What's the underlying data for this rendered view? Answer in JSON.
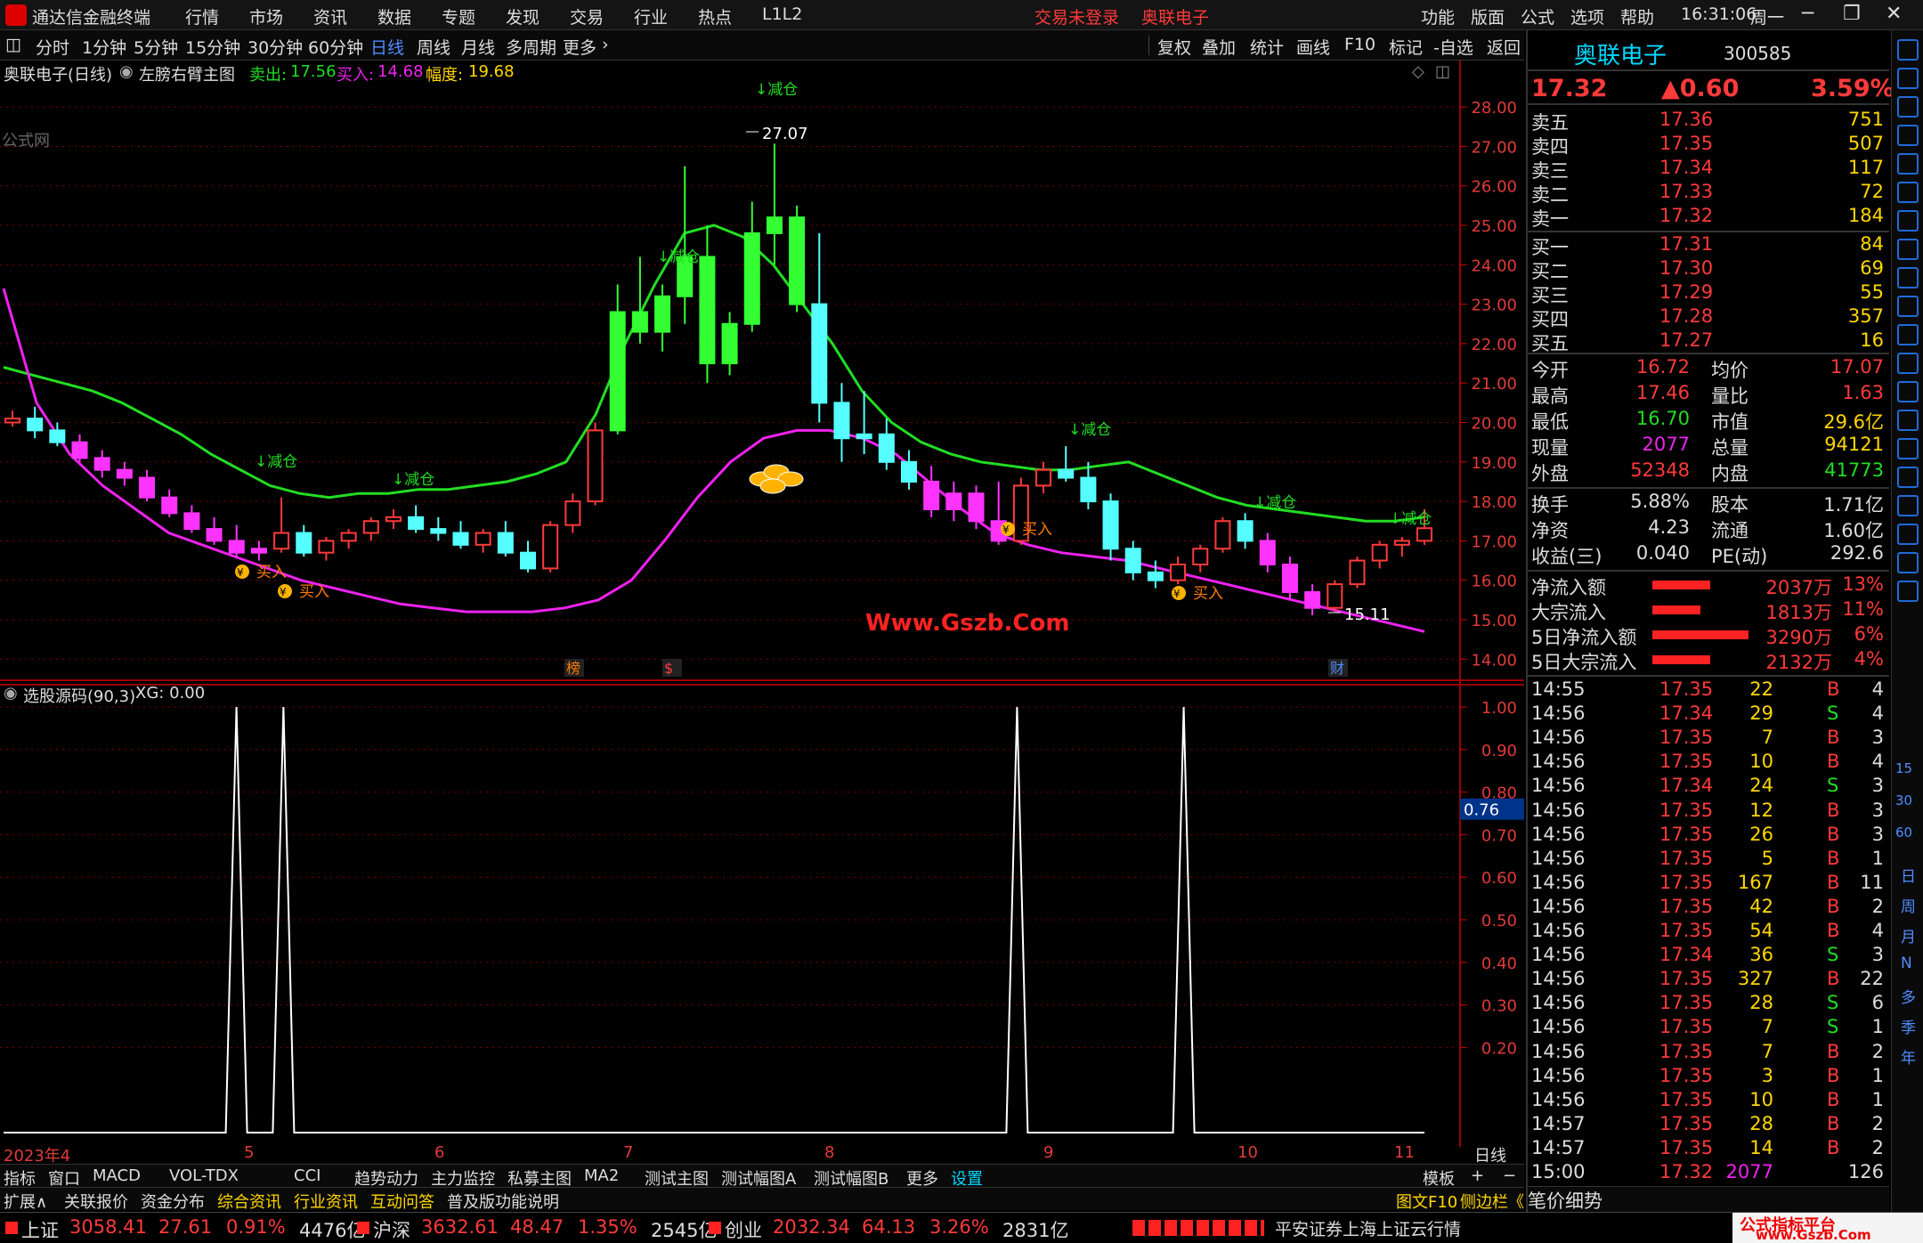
{
  "menubar": {
    "app_name": "通达信金融终端",
    "items": [
      "行情",
      "市场",
      "资讯",
      "数据",
      "专题",
      "发现",
      "交易",
      "行业",
      "热点",
      "L1L2"
    ],
    "notice": "交易未登录",
    "stock": "奥联电子",
    "right_items": [
      "功能",
      "版面",
      "公式",
      "选项",
      "帮助"
    ],
    "clock": "16:31:06",
    "weekday": "周一"
  },
  "toolbar": {
    "periods": [
      "分时",
      "1分钟",
      "5分钟",
      "15分钟",
      "30分钟",
      "60分钟",
      "日线",
      "周线",
      "月线",
      "多周期",
      "更多"
    ],
    "active_period": "日线",
    "tools": [
      "复权",
      "叠加",
      "统计",
      "画线",
      "F10",
      "标记",
      "-自选",
      "返回"
    ]
  },
  "infobar": {
    "stock_title": "奥联电子(日线)",
    "indicator": "左膀右臂主图",
    "sell_label": "卖出:",
    "sell_value": "17.56",
    "buy_label": "买入:",
    "buy_value": "14.68",
    "amp_label": "幅度:",
    "amp_value": "19.68",
    "watermark": "公式网"
  },
  "chart_data": [
    {
      "type": "candlestick",
      "title": "奥联电子(日线)",
      "y_ticks": [
        "28.00",
        "27.00",
        "26.00",
        "25.00",
        "24.00",
        "23.00",
        "22.00",
        "21.00",
        "20.00",
        "19.00",
        "18.00",
        "17.00",
        "16.00",
        "15.00",
        "14.00"
      ],
      "ylim": [
        13.6,
        28.5
      ],
      "x_ticks": [
        "2023年4",
        "5",
        "6",
        "7",
        "8",
        "9",
        "10",
        "11"
      ],
      "annotations": {
        "high": "27.07",
        "low": "15.11",
        "reduce": "↓减仓",
        "buy": "买入",
        "money": "¥",
        "site": "Www.Gszb.Com"
      },
      "markers": [
        "榜",
        "$",
        "财"
      ],
      "series": [
        {
          "name": "upper",
          "color": "#22dd22",
          "values": [
            21.4,
            21.2,
            21.0,
            20.8,
            20.5,
            20.1,
            19.7,
            19.2,
            18.8,
            18.4,
            18.2,
            18.1,
            18.2,
            18.2,
            18.3,
            18.3,
            18.4,
            18.5,
            18.7,
            19.0,
            20.2,
            22.0,
            23.5,
            24.8,
            25.0,
            24.7,
            24.0,
            23.0,
            22.0,
            20.8,
            20.0,
            19.5,
            19.2,
            19.0,
            18.9,
            18.8,
            18.8,
            18.9,
            19.0,
            18.7,
            18.4,
            18.1,
            17.9,
            17.8,
            17.7,
            17.6,
            17.5,
            17.5,
            17.6
          ]
        },
        {
          "name": "lower",
          "color": "#ee22ee",
          "values": [
            23.4,
            20.5,
            19.2,
            18.4,
            17.8,
            17.2,
            16.9,
            16.6,
            16.3,
            16.0,
            15.8,
            15.6,
            15.4,
            15.3,
            15.2,
            15.2,
            15.2,
            15.3,
            15.5,
            16.0,
            17.0,
            18.1,
            19.0,
            19.6,
            19.8,
            19.8,
            19.6,
            19.2,
            18.5,
            17.8,
            17.2,
            16.9,
            16.7,
            16.6,
            16.5,
            16.3,
            16.1,
            15.9,
            15.7,
            15.5,
            15.3,
            15.1,
            14.9,
            14.7
          ]
        },
        {
          "name": "candles",
          "values": [
            [
              20.0,
              20.3,
              19.9,
              20.1
            ],
            [
              20.1,
              20.4,
              19.6,
              19.8
            ],
            [
              19.8,
              20.0,
              19.4,
              19.5
            ],
            [
              19.5,
              19.7,
              19.0,
              19.1
            ],
            [
              19.1,
              19.3,
              18.6,
              18.8
            ],
            [
              18.8,
              19.0,
              18.4,
              18.6
            ],
            [
              18.6,
              18.8,
              18.0,
              18.1
            ],
            [
              18.1,
              18.3,
              17.6,
              17.7
            ],
            [
              17.7,
              17.9,
              17.2,
              17.3
            ],
            [
              17.3,
              17.6,
              16.9,
              17.0
            ],
            [
              17.0,
              17.4,
              16.6,
              16.7
            ],
            [
              16.7,
              17.0,
              16.5,
              16.8
            ],
            [
              16.8,
              18.1,
              16.7,
              17.2
            ],
            [
              17.2,
              17.4,
              16.6,
              16.7
            ],
            [
              16.7,
              17.1,
              16.5,
              17.0
            ],
            [
              17.0,
              17.3,
              16.8,
              17.2
            ],
            [
              17.2,
              17.6,
              17.0,
              17.5
            ],
            [
              17.5,
              17.8,
              17.3,
              17.6
            ],
            [
              17.6,
              17.9,
              17.2,
              17.3
            ],
            [
              17.3,
              17.6,
              17.0,
              17.2
            ],
            [
              17.2,
              17.5,
              16.8,
              16.9
            ],
            [
              16.9,
              17.3,
              16.7,
              17.2
            ],
            [
              17.2,
              17.5,
              16.6,
              16.7
            ],
            [
              16.7,
              17.0,
              16.2,
              16.3
            ],
            [
              16.3,
              17.5,
              16.2,
              17.4
            ],
            [
              17.4,
              18.2,
              17.2,
              18.0
            ],
            [
              18.0,
              20.0,
              17.9,
              19.8
            ],
            [
              19.8,
              23.5,
              19.7,
              22.8
            ],
            [
              22.8,
              24.2,
              22.0,
              22.3
            ],
            [
              22.3,
              23.5,
              21.8,
              23.2
            ],
            [
              23.2,
              26.5,
              22.5,
              24.2
            ],
            [
              24.2,
              25.0,
              21.0,
              21.5
            ],
            [
              21.5,
              22.8,
              21.2,
              22.5
            ],
            [
              22.5,
              25.6,
              22.3,
              24.8
            ],
            [
              24.8,
              27.07,
              24.0,
              25.2
            ],
            [
              25.2,
              25.5,
              22.8,
              23.0
            ],
            [
              23.0,
              24.8,
              20.0,
              20.5
            ],
            [
              20.5,
              21.0,
              19.0,
              19.6
            ],
            [
              19.6,
              20.8,
              19.2,
              19.7
            ],
            [
              19.7,
              20.1,
              18.8,
              19.0
            ],
            [
              19.0,
              19.3,
              18.3,
              18.5
            ],
            [
              18.5,
              18.9,
              17.6,
              17.8
            ],
            [
              17.8,
              18.5,
              17.5,
              18.2
            ],
            [
              18.2,
              18.4,
              17.3,
              17.5
            ],
            [
              17.5,
              18.5,
              16.9,
              17.0
            ],
            [
              17.0,
              18.6,
              16.9,
              18.4
            ],
            [
              18.4,
              19.0,
              18.2,
              18.8
            ],
            [
              18.8,
              19.4,
              18.5,
              18.6
            ],
            [
              18.6,
              19.0,
              17.8,
              18.0
            ],
            [
              18.0,
              18.2,
              16.5,
              16.8
            ],
            [
              16.8,
              17.0,
              16.0,
              16.2
            ],
            [
              16.2,
              16.5,
              15.8,
              16.0
            ],
            [
              16.0,
              16.6,
              15.9,
              16.4
            ],
            [
              16.4,
              16.9,
              16.2,
              16.8
            ],
            [
              16.8,
              17.6,
              16.7,
              17.5
            ],
            [
              17.5,
              17.7,
              16.8,
              17.0
            ],
            [
              17.0,
              17.2,
              16.2,
              16.4
            ],
            [
              16.4,
              16.6,
              15.5,
              15.7
            ],
            [
              15.7,
              15.9,
              15.11,
              15.3
            ],
            [
              15.3,
              16.0,
              15.2,
              15.9
            ],
            [
              15.9,
              16.6,
              15.8,
              16.5
            ],
            [
              16.5,
              17.0,
              16.3,
              16.9
            ],
            [
              16.9,
              17.1,
              16.6,
              17.0
            ],
            [
              17.0,
              17.8,
              16.9,
              17.32
            ]
          ]
        }
      ]
    },
    {
      "type": "line",
      "title": "选股源码(90,3)",
      "legend": "XG: 0.00",
      "y_ticks": [
        "1.00",
        "0.90",
        "0.80",
        "0.70",
        "0.60",
        "0.50",
        "0.40",
        "0.30",
        "0.20"
      ],
      "ylim": [
        0,
        1.0
      ],
      "current": "0.76",
      "series": [
        {
          "name": "XG",
          "color": "#ffffff",
          "spikes": [
            0.166,
            0.199,
            0.714,
            0.831
          ]
        }
      ]
    }
  ],
  "quote": {
    "name": "奥联电子",
    "code": "300585",
    "price": "17.32",
    "change": "▲0.60",
    "pct": "3.59%",
    "asks": [
      {
        "label": "卖五",
        "price": "17.36",
        "vol": "751"
      },
      {
        "label": "卖四",
        "price": "17.35",
        "vol": "507"
      },
      {
        "label": "卖三",
        "price": "17.34",
        "vol": "117"
      },
      {
        "label": "卖二",
        "price": "17.33",
        "vol": "72"
      },
      {
        "label": "卖一",
        "price": "17.32",
        "vol": "184"
      }
    ],
    "bids": [
      {
        "label": "买一",
        "price": "17.31",
        "vol": "84"
      },
      {
        "label": "买二",
        "price": "17.30",
        "vol": "69"
      },
      {
        "label": "买三",
        "price": "17.29",
        "vol": "55"
      },
      {
        "label": "买四",
        "price": "17.28",
        "vol": "357"
      },
      {
        "label": "买五",
        "price": "17.27",
        "vol": "16"
      }
    ],
    "stats": [
      [
        "今开",
        "16.72",
        "均价",
        "17.07"
      ],
      [
        "最高",
        "17.46",
        "量比",
        "1.63"
      ],
      [
        "最低",
        "16.70",
        "市值",
        "29.6亿"
      ],
      [
        "现量",
        "2077",
        "总量",
        "94121"
      ],
      [
        "外盘",
        "52348",
        "内盘",
        "41773"
      ]
    ],
    "stats2": [
      [
        "换手",
        "5.88%",
        "股本",
        "1.71亿"
      ],
      [
        "净资",
        "4.23",
        "流通",
        "1.60亿"
      ],
      [
        "收益(三)",
        "0.040",
        "PE(动)",
        "292.6"
      ]
    ],
    "flows": [
      [
        "净流入额",
        "2037万",
        "13%",
        0.6
      ],
      [
        "大宗流入",
        "1813万",
        "11%",
        0.5
      ],
      [
        "5日净流入额",
        "3290万",
        "6%",
        1.0
      ],
      [
        "5日大宗流入",
        "2132万",
        "4%",
        0.6
      ]
    ],
    "ticks": [
      [
        "14:55",
        "17.35",
        "22",
        "B",
        "4"
      ],
      [
        "14:56",
        "17.34",
        "29",
        "S",
        "4"
      ],
      [
        "14:56",
        "17.35",
        "7",
        "B",
        "3"
      ],
      [
        "14:56",
        "17.35",
        "10",
        "B",
        "4"
      ],
      [
        "14:56",
        "17.34",
        "24",
        "S",
        "3"
      ],
      [
        "14:56",
        "17.35",
        "12",
        "B",
        "3"
      ],
      [
        "14:56",
        "17.35",
        "26",
        "B",
        "3"
      ],
      [
        "14:56",
        "17.35",
        "5",
        "B",
        "1"
      ],
      [
        "14:56",
        "17.35",
        "167",
        "B",
        "11"
      ],
      [
        "14:56",
        "17.35",
        "42",
        "B",
        "2"
      ],
      [
        "14:56",
        "17.35",
        "54",
        "B",
        "4"
      ],
      [
        "14:56",
        "17.34",
        "36",
        "S",
        "3"
      ],
      [
        "14:56",
        "17.35",
        "327",
        "B",
        "22"
      ],
      [
        "14:56",
        "17.35",
        "28",
        "S",
        "6"
      ],
      [
        "14:56",
        "17.35",
        "7",
        "S",
        "1"
      ],
      [
        "14:56",
        "17.35",
        "7",
        "B",
        "2"
      ],
      [
        "14:56",
        "17.35",
        "3",
        "B",
        "1"
      ],
      [
        "14:56",
        "17.35",
        "10",
        "B",
        "1"
      ],
      [
        "14:57",
        "17.35",
        "28",
        "B",
        "2"
      ],
      [
        "14:57",
        "17.35",
        "14",
        "B",
        "2"
      ],
      [
        "15:00",
        "17.32",
        "2077",
        "",
        "126"
      ]
    ],
    "bottom_tabs": [
      "笔",
      "价",
      "细",
      "势"
    ]
  },
  "tabs1": [
    "指标",
    "窗口",
    "MACD",
    "VOL-TDX",
    "CCI",
    "趋势动力",
    "主力监控",
    "私募主图",
    "MA2",
    "测试主图",
    "测试幅图A",
    "测试幅图B",
    "更多",
    "设置"
  ],
  "tabs1_right": [
    "模板",
    "+",
    "−"
  ],
  "tabs2": [
    "扩展∧",
    "关联报价",
    "资金分布",
    "综合资讯",
    "行业资讯",
    "互动问答",
    "普及版功能说明"
  ],
  "tabs2_right": [
    "图文F10",
    "侧边栏《"
  ],
  "status": {
    "indices": [
      [
        "上证",
        "3058.41",
        "27.61",
        "0.91%",
        "4476亿"
      ],
      [
        "沪深",
        "3632.61",
        "48.47",
        "1.35%",
        "2545亿"
      ],
      [
        "创业",
        "2032.34",
        "64.13",
        "3.26%",
        "2831亿"
      ]
    ],
    "broker": "平安证券上海上证云行情",
    "brand": "公式指标平台",
    "brand_url": "www.Gszb.Com"
  },
  "strip": [
    "日",
    "周",
    "月",
    "N",
    "多",
    "季",
    "年",
    "15",
    "30",
    "60"
  ]
}
